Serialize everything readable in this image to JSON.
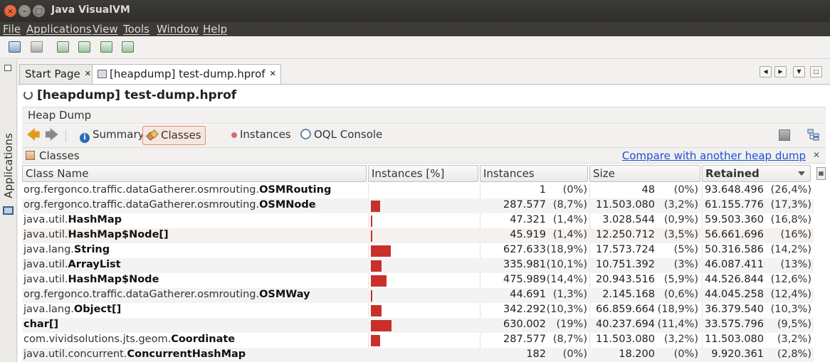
{
  "window": {
    "title": "Java VisualVM"
  },
  "menu": [
    "File",
    "Applications",
    "View",
    "Tools",
    "Window",
    "Help"
  ],
  "sidebar": {
    "label": "Applications"
  },
  "tabs": [
    {
      "label": "Start Page",
      "close": "✕"
    },
    {
      "label": "[heapdump] test-dump.hprof",
      "close": "✕"
    }
  ],
  "nav_buttons": [
    "◀",
    "▶",
    "▼",
    "□"
  ],
  "heap": {
    "title": "[heapdump] test-dump.hprof",
    "section": "Heap Dump"
  },
  "views": [
    {
      "label": "Summary",
      "icon": "info-icon"
    },
    {
      "label": "Classes",
      "icon": "classes-icon",
      "selected": true
    },
    {
      "label": "Instances",
      "icon": "instances-dot-icon"
    },
    {
      "label": "OQL Console",
      "icon": "oql-icon"
    }
  ],
  "classes_panel": {
    "title": "Classes",
    "compare_link": "Compare with another heap dump",
    "close": "✕"
  },
  "table": {
    "columns": [
      "Class Name",
      "Instances [%]",
      "Instances",
      "Size",
      "Retained"
    ],
    "sorted_column": "Retained",
    "rows": [
      {
        "pkg": "org.fergonco.traffic.dataGatherer.osmrouting.",
        "cls": "OSMRouting",
        "bar_pct": 0,
        "inst": "1",
        "inst_pct": "(0%)",
        "size": "48",
        "size_pct": "(0%)",
        "ret": "93.648.496",
        "ret_pct": "(26,4%)"
      },
      {
        "pkg": "org.fergonco.traffic.dataGatherer.osmrouting.",
        "cls": "OSMNode",
        "bar_pct": 8.7,
        "inst": "287.577",
        "inst_pct": "(8,7%)",
        "size": "11.503.080",
        "size_pct": "(3,2%)",
        "ret": "61.155.776",
        "ret_pct": "(17,3%)"
      },
      {
        "pkg": "java.util.",
        "cls": "HashMap",
        "bar_pct": 1.4,
        "inst": "47.321",
        "inst_pct": "(1,4%)",
        "size": "3.028.544",
        "size_pct": "(0,9%)",
        "ret": "59.503.360",
        "ret_pct": "(16,8%)"
      },
      {
        "pkg": "java.util.",
        "cls": "HashMap$Node[]",
        "bar_pct": 1.4,
        "inst": "45.919",
        "inst_pct": "(1,4%)",
        "size": "12.250.712",
        "size_pct": "(3,5%)",
        "ret": "56.661.696",
        "ret_pct": "(16%)"
      },
      {
        "pkg": "java.lang.",
        "cls": "String",
        "bar_pct": 18.9,
        "inst": "627.633",
        "inst_pct": "(18,9%)",
        "size": "17.573.724",
        "size_pct": "(5%)",
        "ret": "50.316.586",
        "ret_pct": "(14,2%)"
      },
      {
        "pkg": "java.util.",
        "cls": "ArrayList",
        "bar_pct": 10.1,
        "inst": "335.981",
        "inst_pct": "(10,1%)",
        "size": "10.751.392",
        "size_pct": "(3%)",
        "ret": "46.087.411",
        "ret_pct": "(13%)"
      },
      {
        "pkg": "java.util.",
        "cls": "HashMap$Node",
        "bar_pct": 14.4,
        "inst": "475.989",
        "inst_pct": "(14,4%)",
        "size": "20.943.516",
        "size_pct": "(5,9%)",
        "ret": "44.526.844",
        "ret_pct": "(12,6%)"
      },
      {
        "pkg": "org.fergonco.traffic.dataGatherer.osmrouting.",
        "cls": "OSMWay",
        "bar_pct": 1.3,
        "inst": "44.691",
        "inst_pct": "(1,3%)",
        "size": "2.145.168",
        "size_pct": "(0,6%)",
        "ret": "44.045.258",
        "ret_pct": "(12,4%)"
      },
      {
        "pkg": "java.lang.",
        "cls": "Object[]",
        "bar_pct": 10.3,
        "inst": "342.292",
        "inst_pct": "(10,3%)",
        "size": "66.859.664",
        "size_pct": "(18,9%)",
        "ret": "36.379.540",
        "ret_pct": "(10,3%)"
      },
      {
        "pkg": "",
        "cls": "char[]",
        "bar_pct": 19,
        "inst": "630.002",
        "inst_pct": "(19%)",
        "size": "40.237.694",
        "size_pct": "(11,4%)",
        "ret": "33.575.796",
        "ret_pct": "(9,5%)"
      },
      {
        "pkg": "com.vividsolutions.jts.geom.",
        "cls": "Coordinate",
        "bar_pct": 8.7,
        "inst": "287.577",
        "inst_pct": "(8,7%)",
        "size": "11.503.080",
        "size_pct": "(3,2%)",
        "ret": "11.503.080",
        "ret_pct": "(3,2%)"
      },
      {
        "pkg": "java.util.concurrent.",
        "cls": "ConcurrentHashMap",
        "bar_pct": 0,
        "inst": "182",
        "inst_pct": "(0%)",
        "size": "18.200",
        "size_pct": "(0%)",
        "ret": "9.920.361",
        "ret_pct": "(2,8%)"
      }
    ]
  },
  "colors": {
    "bar": "#c9302c",
    "link": "#1a4fd6",
    "titlebar": "#3c3b37",
    "selected_view": "#e6926a"
  }
}
